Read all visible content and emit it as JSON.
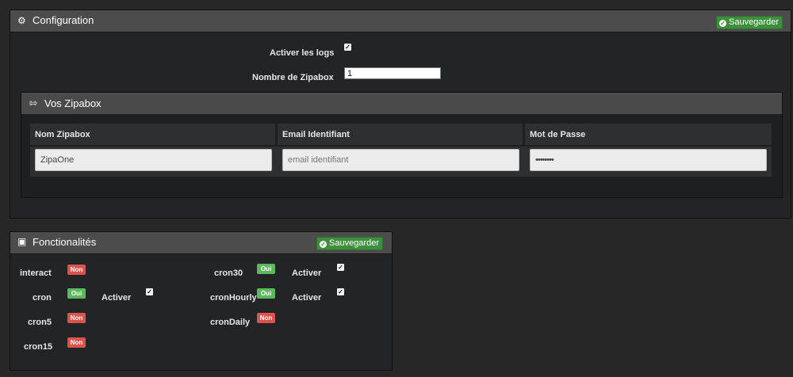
{
  "config": {
    "title": "Configuration",
    "save_label": "Sauvegarder",
    "icon": "gears-icon",
    "logs_label": "Activer les logs",
    "logs_checked": true,
    "count_label": "Nombre de Zipabox",
    "count_value": "1"
  },
  "zipabox": {
    "title": "Vos Zipabox",
    "icon": "usb-icon",
    "columns": [
      "Nom Zipabox",
      "Email Identifiant",
      "Mot de Passe"
    ],
    "name_value": "ZipaOne",
    "email_placeholder": "email identifiant",
    "password_value": "••••••••"
  },
  "features": {
    "title": "Fonctionalités",
    "save_label": "Sauvegarder",
    "icon": "image-icon",
    "activate_label": "Activer",
    "items": [
      {
        "name": "interact",
        "status": "Non"
      },
      {
        "name": "cron",
        "status": "Oui"
      },
      {
        "name": "cron5",
        "status": "Non"
      },
      {
        "name": "cron15",
        "status": "Non"
      },
      {
        "name": "cron30",
        "status": "Oui"
      },
      {
        "name": "cronHourly",
        "status": "Oui"
      },
      {
        "name": "cronDaily",
        "status": "Non"
      }
    ]
  },
  "colors": {
    "oui": "#5cb85c",
    "non": "#d9534f",
    "save": "#3e8e3e"
  }
}
